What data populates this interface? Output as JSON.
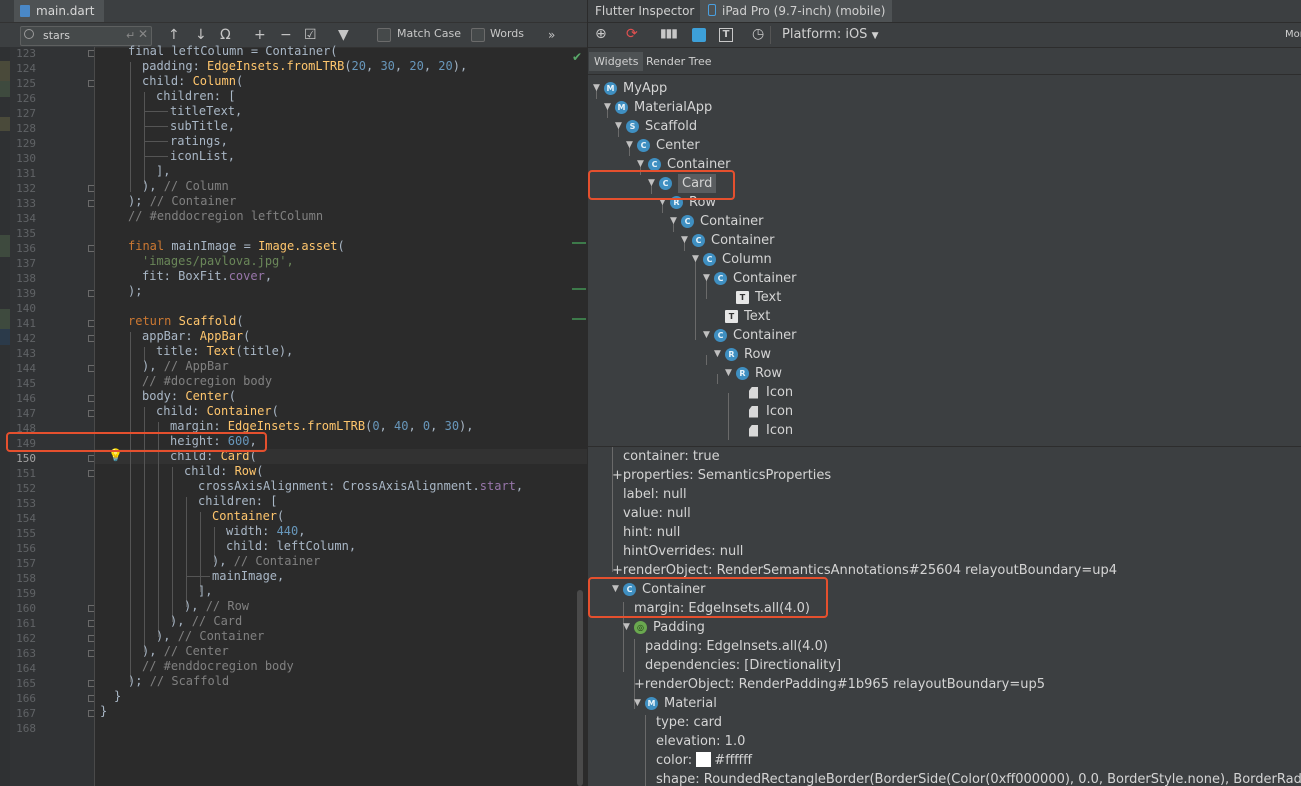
{
  "editor": {
    "tab_label": "main.dart",
    "search": {
      "value": "stars",
      "enter_glyph": "↵",
      "clear_glyph": "✕"
    },
    "toolbar": {
      "up": "↑",
      "down": "↓",
      "find_all": "Ω",
      "add_sel": "+",
      "remove_sel": "−",
      "select_all": "☑",
      "filter": "▼",
      "more": "»"
    },
    "match_case_label": "Match Case",
    "words_label": "Words",
    "line_numbers": [
      "123",
      "124",
      "125",
      "126",
      "127",
      "128",
      "129",
      "130",
      "131",
      "132",
      "133",
      "134",
      "135",
      "136",
      "137",
      "138",
      "139",
      "140",
      "141",
      "142",
      "143",
      "144",
      "145",
      "146",
      "147",
      "148",
      "149",
      "150",
      "151",
      "152",
      "153",
      "154",
      "155",
      "156",
      "157",
      "158",
      "159",
      "160",
      "161",
      "162",
      "163",
      "164",
      "165",
      "166",
      "167",
      "168"
    ],
    "current_line": "150",
    "code": {
      "l123": "final leftColumn = Container(",
      "l124a": "padding: ",
      "l124b": "EdgeInsets.fromLTRB",
      "l124c": "(",
      "l124d": "20",
      "l124e": ", ",
      "l124f": "30",
      "l124g": ", ",
      "l124h": "20",
      "l124i": ", ",
      "l124j": "20",
      "l124k": "),",
      "l125a": "child: ",
      "l125b": "Column",
      "l125c": "(",
      "l126": "children: [",
      "l127": "titleText,",
      "l128": "subTitle,",
      "l129": "ratings,",
      "l130": "iconList,",
      "l131": "],",
      "l132a": "), ",
      "l132b": "// Column",
      "l133a": "); ",
      "l133b": "// Container",
      "l134": "// #enddocregion leftColumn",
      "l136a": "final ",
      "l136b": "mainImage = ",
      "l136c": "Image.asset",
      "l136d": "(",
      "l137": "'images/pavlova.jpg',",
      "l138a": "fit: BoxFit.",
      "l138b": "cover",
      "l138c": ",",
      "l139": ");",
      "l141a": "return ",
      "l141b": "Scaffold",
      "l141c": "(",
      "l142a": "appBar: ",
      "l142b": "AppBar",
      "l142c": "(",
      "l143a": "title: ",
      "l143b": "Text",
      "l143c": "(title),",
      "l144a": "), ",
      "l144b": "// AppBar",
      "l145": "// #docregion body",
      "l146a": "body: ",
      "l146b": "Center",
      "l146c": "(",
      "l147a": "child: ",
      "l147b": "Container",
      "l147c": "(",
      "l148a": "margin: ",
      "l148b": "EdgeInsets.fromLTRB",
      "l148c": "(",
      "l148d": "0",
      "l148e": ", ",
      "l148f": "40",
      "l148g": ", ",
      "l148h": "0",
      "l148i": ", ",
      "l148j": "30",
      "l148k": "),",
      "l149a": "height: ",
      "l149b": "600",
      "l149c": ",",
      "l150a": "child: ",
      "l150b": "Card",
      "l150c": "(",
      "l151a": "child: ",
      "l151b": "Row",
      "l151c": "(",
      "l152a": "crossAxisAlignment: CrossAxisAlignment.",
      "l152b": "start",
      "l152c": ",",
      "l153": "children: [",
      "l154a": "Container",
      "l154b": "(",
      "l155a": "width: ",
      "l155b": "440",
      "l155c": ",",
      "l156": "child: leftColumn,",
      "l157a": "), ",
      "l157b": "// Container",
      "l158": "mainImage,",
      "l159": "],",
      "l160a": "), ",
      "l160b": "// Row",
      "l161a": "), ",
      "l161b": "// Card",
      "l162a": "), ",
      "l162b": "// Container",
      "l163a": "), ",
      "l163b": "// Center",
      "l164": "// #enddocregion body",
      "l165a": "); ",
      "l165b": "// Scaffold",
      "l166": "}",
      "l167": "}"
    }
  },
  "inspector": {
    "tab_title": "Flutter Inspector",
    "device_tab": "iPad Pro (9.7-inch) (mobile)",
    "platform_label": "Platform: iOS",
    "more_label": "Mor",
    "subtabs": [
      "Widgets",
      "Render Tree"
    ],
    "tree": [
      {
        "label": "MyApp",
        "badge": "M"
      },
      {
        "label": "MaterialApp",
        "badge": "M"
      },
      {
        "label": "Scaffold",
        "badge": "S"
      },
      {
        "label": "Center",
        "badge": "C"
      },
      {
        "label": "Container",
        "badge": "C"
      },
      {
        "label": "Card",
        "badge": "C"
      },
      {
        "label": "Row",
        "badge": "R"
      },
      {
        "label": "Container",
        "badge": "C"
      },
      {
        "label": "Container",
        "badge": "C"
      },
      {
        "label": "Column",
        "badge": "C"
      },
      {
        "label": "Container",
        "badge": "C"
      },
      {
        "label": "Text",
        "badge": "T"
      },
      {
        "label": "Text",
        "badge": "T"
      },
      {
        "label": "Container",
        "badge": "C"
      },
      {
        "label": "Row",
        "badge": "R"
      },
      {
        "label": "Row",
        "badge": "R"
      },
      {
        "label": "Icon",
        "badge": ""
      },
      {
        "label": "Icon",
        "badge": ""
      },
      {
        "label": "Icon",
        "badge": ""
      }
    ],
    "details": {
      "d0": "container: true",
      "d1": "+properties: SemanticsProperties",
      "d2": "label: null",
      "d3": "value: null",
      "d4": "hint: null",
      "d5": "hintOverrides: null",
      "d6": "+renderObject: RenderSemanticsAnnotations#25604 relayoutBoundary=up4",
      "d7": "Container",
      "d8": "margin: EdgeInsets.all(4.0)",
      "d9": "Padding",
      "d10": "padding: EdgeInsets.all(4.0)",
      "d11": "dependencies: [Directionality]",
      "d12": "+renderObject: RenderPadding#1b965 relayoutBoundary=up5",
      "d13": "Material",
      "d14": "type: card",
      "d15": "elevation: 1.0",
      "d16a": "color: ",
      "d16b": "#ffffff",
      "d17": "shape: RoundedRectangleBorder(BorderSide(Color(0xff000000), 0.0, BorderStyle.none), BorderRadius.cir"
    }
  },
  "colors": {
    "highlight": "#e5502e",
    "badge": "#3f8fc1",
    "swatch": "#ffffff"
  }
}
